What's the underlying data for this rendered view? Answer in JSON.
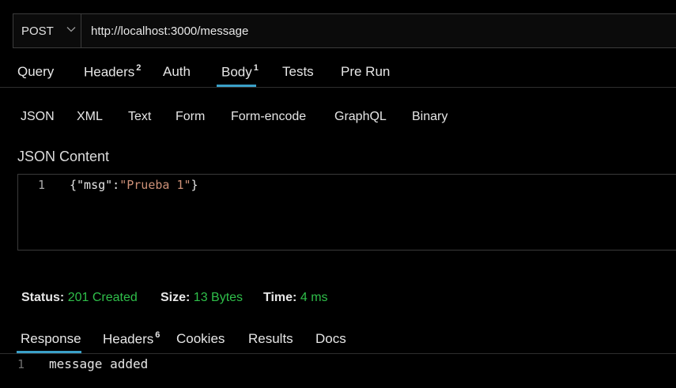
{
  "request": {
    "method": "POST",
    "url": "http://localhost:3000/message"
  },
  "request_tabs": [
    {
      "label": "Query",
      "badge": ""
    },
    {
      "label": "Headers",
      "badge": "2"
    },
    {
      "label": "Auth",
      "badge": ""
    },
    {
      "label": "Body",
      "badge": "1",
      "active": true
    },
    {
      "label": "Tests",
      "badge": ""
    },
    {
      "label": "Pre Run",
      "badge": ""
    }
  ],
  "body_types": [
    "JSON",
    "XML",
    "Text",
    "Form",
    "Form-encode",
    "GraphQL",
    "Binary"
  ],
  "editor": {
    "title": "JSON Content",
    "line_number": "1",
    "code_prefix": "{\"msg\":",
    "code_string": "\"Prueba 1\"",
    "code_suffix": "}"
  },
  "status": {
    "status_label": "Status:",
    "status_value": "201 Created",
    "size_label": "Size:",
    "size_value": "13 Bytes",
    "time_label": "Time:",
    "time_value": "4 ms"
  },
  "response_tabs": [
    {
      "label": "Response",
      "badge": "",
      "active": true
    },
    {
      "label": "Headers",
      "badge": "6"
    },
    {
      "label": "Cookies",
      "badge": ""
    },
    {
      "label": "Results",
      "badge": ""
    },
    {
      "label": "Docs",
      "badge": ""
    }
  ],
  "response": {
    "line_number": "1",
    "text": "message added"
  },
  "colors": {
    "accent": "#3aa0c8",
    "success": "#2fbf4a",
    "string": "#ce9178"
  }
}
